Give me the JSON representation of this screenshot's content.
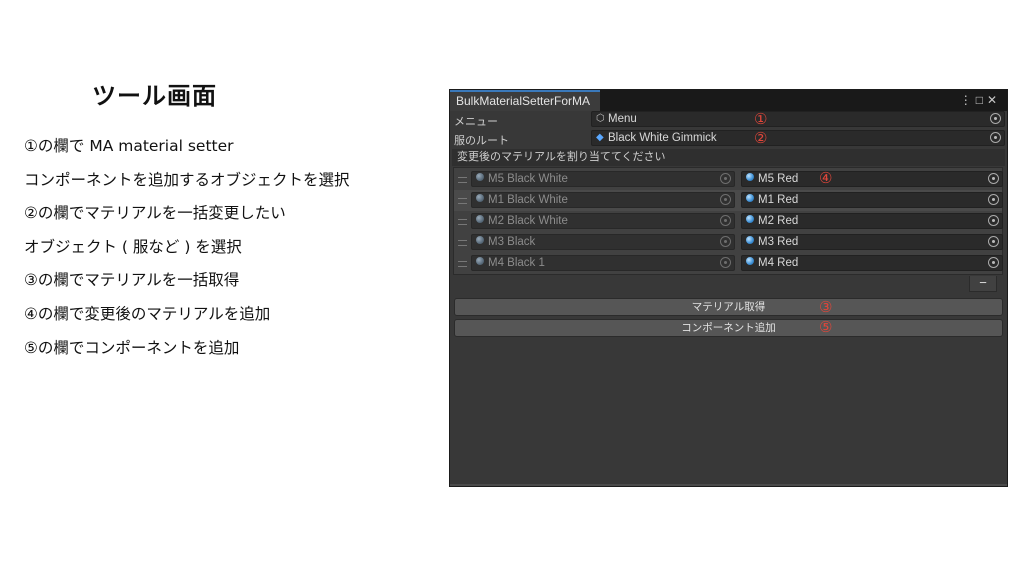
{
  "slide": {
    "title": "ツール画面",
    "notes": [
      "①の欄で MA material setter",
      "コンポーネントを追加するオブジェクトを選択",
      "②の欄でマテリアルを一括変更したい",
      "オブジェクト ( 服など ) を選択",
      "③の欄でマテリアルを一括取得",
      "④の欄で変更後のマテリアルを追加",
      "⑤の欄でコンポーネントを追加"
    ]
  },
  "window": {
    "tab_title": "BulkMaterialSetterForMA",
    "menu_label": "メニュー",
    "menu_value": "Menu",
    "menu_icon": "cube-outline-icon",
    "root_label": "服のルート",
    "root_value": "Black White Gimmick",
    "root_icon": "prefab-cube-icon",
    "section_header": "変更後のマテリアルを割り当ててください",
    "materials": [
      {
        "from": "M5 Black White",
        "to": "M5 Red"
      },
      {
        "from": "M1 Black White",
        "to": "M1 Red"
      },
      {
        "from": "M2 Black White",
        "to": "M2 Red"
      },
      {
        "from": "M3 Black",
        "to": "M3 Red"
      },
      {
        "from": "M4 Black 1",
        "to": "M4 Red"
      }
    ],
    "remove_label": "−",
    "get_materials_button": "マテリアル取得",
    "add_component_button": "コンポーネント追加"
  },
  "annotations": {
    "n1": "①",
    "n2": "②",
    "n3": "③",
    "n4": "④",
    "n5": "⑤",
    "color": "#e0463a"
  }
}
